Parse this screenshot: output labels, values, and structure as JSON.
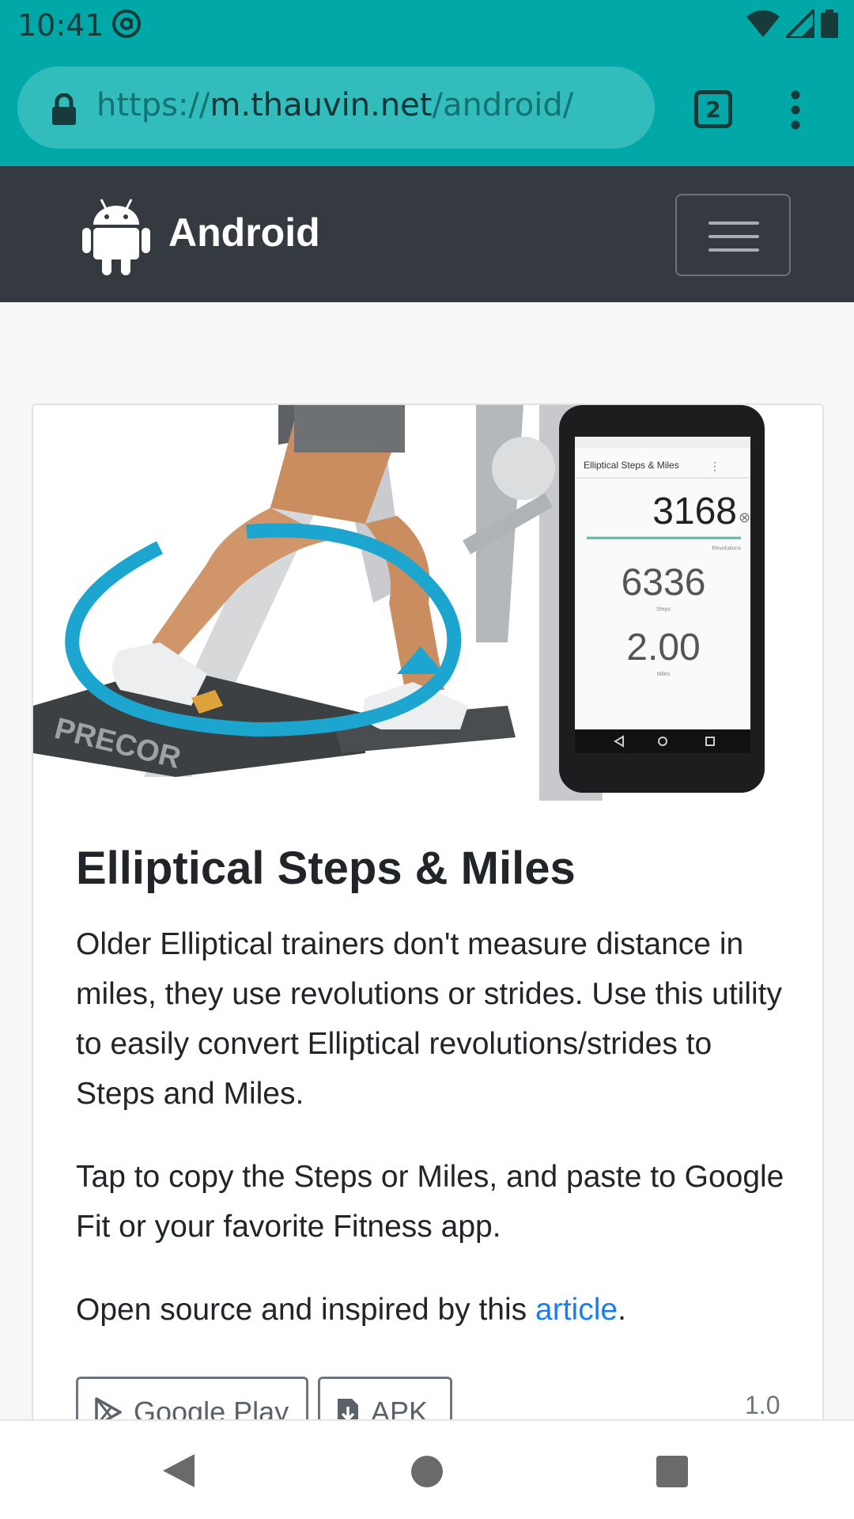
{
  "status_bar": {
    "time": "10:41"
  },
  "browser": {
    "url_scheme": "https://",
    "url_host": "m.thauvin.net",
    "url_path": "/android/",
    "tab_count": "2"
  },
  "site": {
    "brand": "Android"
  },
  "card": {
    "title": "Elliptical Steps & Miles",
    "paragraph1": "Older Elliptical trainers don't measure distance in miles, they use revolutions or strides. Use this utility to easily convert Elliptical revolutions/strides to Steps and Miles.",
    "paragraph2": "Tap to copy the Steps or Miles, and paste to Google Fit or your favorite Fitness app.",
    "paragraph3_prefix": "Open source and inspired by this ",
    "paragraph3_link": "article",
    "paragraph3_suffix": ".",
    "google_play_label": "Google Play",
    "apk_label": "APK",
    "version": "1.0"
  },
  "hero_phone": {
    "app_title": "Elliptical Steps & Miles",
    "revolutions": "3168",
    "steps": "6336",
    "miles": "2.00",
    "revolutions_label": "Revolutions",
    "steps_label": "Steps",
    "miles_label": "Miles"
  },
  "hero_brand": "PRECOR",
  "colors": {
    "accent": "#00a8a8",
    "navbar": "#343a40",
    "link": "#1a7df0"
  }
}
